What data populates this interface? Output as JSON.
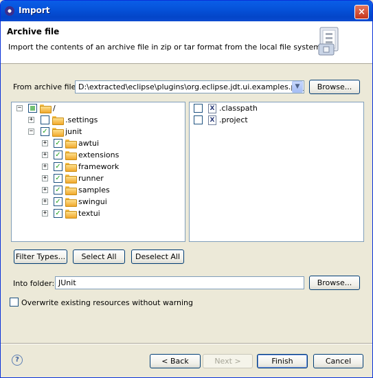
{
  "window": {
    "title": "Import",
    "close_label": "×"
  },
  "header": {
    "title": "Archive file",
    "description": "Import the contents of an archive file in zip or tar format from the local file system."
  },
  "source": {
    "label": "From archive file:",
    "value": "D:\\extracted\\eclipse\\plugins\\org.eclipse.jdt.ui.examples.projects",
    "browse_label": "Browse..."
  },
  "tree": {
    "root": {
      "label": "/",
      "state": "partial"
    },
    "settings": {
      "label": ".settings"
    },
    "junit": {
      "label": "junit"
    },
    "children": [
      {
        "label": "awtui"
      },
      {
        "label": "extensions"
      },
      {
        "label": "framework"
      },
      {
        "label": "runner"
      },
      {
        "label": "samples"
      },
      {
        "label": "swingui"
      },
      {
        "label": "textui"
      }
    ]
  },
  "files": [
    {
      "label": ".classpath",
      "checked": false
    },
    {
      "label": ".project",
      "checked": false
    }
  ],
  "selection_buttons": {
    "filter": "Filter Types...",
    "select_all": "Select All",
    "deselect_all": "Deselect All"
  },
  "target": {
    "label": "Into folder:",
    "value": "JUnit",
    "browse_label": "Browse..."
  },
  "overwrite": {
    "label": "Overwrite existing resources without warning",
    "checked": false
  },
  "footer": {
    "back": "< Back",
    "next": "Next >",
    "finish": "Finish",
    "cancel": "Cancel",
    "help_glyph": "?"
  }
}
